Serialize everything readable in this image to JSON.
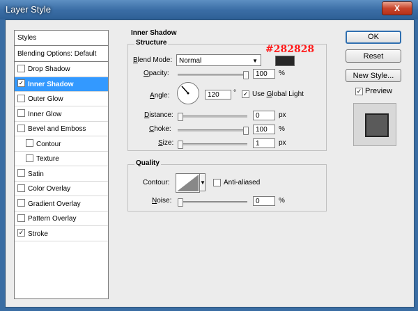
{
  "window": {
    "title": "Layer Style",
    "close_label": "X"
  },
  "style_list": {
    "header": "Styles",
    "blending": "Blending Options: Default",
    "items": [
      {
        "label": "Drop Shadow",
        "checked": false,
        "indent": false,
        "selected": false
      },
      {
        "label": "Inner Shadow",
        "checked": true,
        "indent": false,
        "selected": true
      },
      {
        "label": "Outer Glow",
        "checked": false,
        "indent": false,
        "selected": false
      },
      {
        "label": "Inner Glow",
        "checked": false,
        "indent": false,
        "selected": false
      },
      {
        "label": "Bevel and Emboss",
        "checked": false,
        "indent": false,
        "selected": false
      },
      {
        "label": "Contour",
        "checked": false,
        "indent": true,
        "selected": false
      },
      {
        "label": "Texture",
        "checked": false,
        "indent": true,
        "selected": false
      },
      {
        "label": "Satin",
        "checked": false,
        "indent": false,
        "selected": false
      },
      {
        "label": "Color Overlay",
        "checked": false,
        "indent": false,
        "selected": false
      },
      {
        "label": "Gradient Overlay",
        "checked": false,
        "indent": false,
        "selected": false
      },
      {
        "label": "Pattern Overlay",
        "checked": false,
        "indent": false,
        "selected": false
      },
      {
        "label": "Stroke",
        "checked": true,
        "indent": false,
        "selected": false
      }
    ]
  },
  "inner_shadow": {
    "section_title": "Inner Shadow",
    "structure": {
      "group_title": "Structure",
      "blend_mode_label": "Blend Mode:",
      "blend_mode_value": "Normal",
      "color_hex_label": "#282828",
      "color": "#282828",
      "opacity_label": "Opacity:",
      "opacity_value": "100",
      "opacity_unit": "%",
      "angle_label": "Angle:",
      "angle_value": "120",
      "angle_unit": "°",
      "use_global_light_label": "Use Global Light",
      "use_global_light_checked": true,
      "distance_label": "Distance:",
      "distance_value": "0",
      "distance_unit": "px",
      "choke_label": "Choke:",
      "choke_value": "100",
      "choke_unit": "%",
      "size_label": "Size:",
      "size_value": "1",
      "size_unit": "px"
    },
    "quality": {
      "group_title": "Quality",
      "contour_label": "Contour:",
      "anti_aliased_label": "Anti-aliased",
      "anti_aliased_checked": false,
      "noise_label": "Noise:",
      "noise_value": "0",
      "noise_unit": "%"
    }
  },
  "buttons": {
    "ok": "OK",
    "reset": "Reset",
    "new_style": "New Style...",
    "preview_label": "Preview",
    "preview_checked": true
  },
  "slider_levels": {
    "opacity": 1.0,
    "distance": 0.0,
    "choke": 1.0,
    "size": 0.0,
    "noise": 0.0
  }
}
